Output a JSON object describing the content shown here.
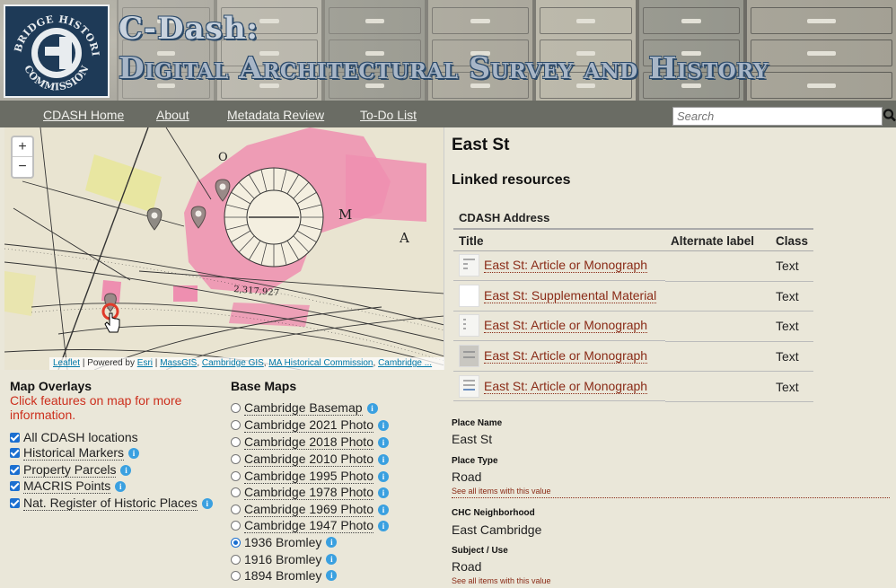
{
  "banner": {
    "logo_text": "CAMBRIDGE HISTORICAL COMMISSION",
    "title_line1": "C-Dash:",
    "title_line2": "Digital Architectural Survey and History"
  },
  "nav": {
    "items": [
      {
        "label": "CDASH Home"
      },
      {
        "label": "About"
      },
      {
        "label": "Metadata Review"
      },
      {
        "label": "To-Do List"
      }
    ],
    "search_placeholder": "Search",
    "search_icon": "magnifier-icon"
  },
  "map": {
    "zoom_in": "+",
    "zoom_out": "−",
    "map_letters": [
      "M",
      "A",
      "O"
    ],
    "parcel_label": "2,317,927",
    "attribution": {
      "leaflet": "Leaflet",
      "powered": "| Powered by",
      "esri": "Esri",
      "sep1": "|",
      "massgis": "MassGIS",
      "cambridge_gis": "Cambridge GIS",
      "sep2": ",",
      "mhc": "MA Historical Commission",
      "sep3": ",",
      "cambridge": "Cambridge ..."
    },
    "colors": {
      "parcel": "#ee8fb0",
      "water": "#e8e6a1",
      "paper": "#e9e4d1"
    }
  },
  "overlays": {
    "title": "Map Overlays",
    "note": "Click features on map for more information.",
    "items": [
      {
        "label": "All CDASH locations",
        "checked": true
      },
      {
        "label": "Historical Markers",
        "checked": true
      },
      {
        "label": "Property Parcels",
        "checked": true
      },
      {
        "label": "MACRIS Points",
        "checked": true
      },
      {
        "label": "Nat. Register of Historic Places",
        "checked": true
      }
    ]
  },
  "basemaps": {
    "title": "Base Maps",
    "items": [
      {
        "label": "Cambridge Basemap",
        "selected": false
      },
      {
        "label": "Cambridge 2021 Photo",
        "selected": false
      },
      {
        "label": "Cambridge 2018 Photo",
        "selected": false
      },
      {
        "label": "Cambridge 2010 Photo",
        "selected": false
      },
      {
        "label": "Cambridge 1995 Photo",
        "selected": false
      },
      {
        "label": "Cambridge 1978 Photo",
        "selected": false
      },
      {
        "label": "Cambridge 1969 Photo",
        "selected": false
      },
      {
        "label": "Cambridge 1947 Photo",
        "selected": false
      },
      {
        "label": "1936 Bromley",
        "selected": true
      },
      {
        "label": "1916 Bromley",
        "selected": false
      },
      {
        "label": "1894 Bromley",
        "selected": false
      }
    ]
  },
  "item": {
    "title": "East St",
    "linked_heading": "Linked resources",
    "table_caption": "CDASH Address",
    "columns": [
      "Title",
      "Alternate label",
      "Class"
    ],
    "rows": [
      {
        "title": "East St: Article or Monograph",
        "alt": "",
        "class": "Text"
      },
      {
        "title": "East St: Supplemental Material",
        "alt": "",
        "class": "Text"
      },
      {
        "title": "East St: Article or Monograph",
        "alt": "",
        "class": "Text"
      },
      {
        "title": "East St: Article or Monograph",
        "alt": "",
        "class": "Text"
      },
      {
        "title": "East St: Article or Monograph",
        "alt": "",
        "class": "Text"
      }
    ],
    "fields": {
      "place_name_label": "Place Name",
      "place_name": "East St",
      "place_type_label": "Place Type",
      "place_type": "Road",
      "see_all": "See all items with this value",
      "neighborhood_label": "CHC Neighborhood",
      "neighborhood": "East Cambridge",
      "subject_label": "Subject / Use",
      "subject": "Road"
    }
  }
}
